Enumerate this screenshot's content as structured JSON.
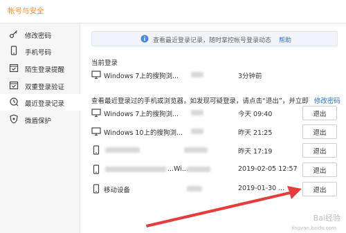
{
  "header": {
    "title": "帐号与安全"
  },
  "sidebar": {
    "items": [
      {
        "label": "修改密码",
        "icon": "key-icon"
      },
      {
        "label": "手机号码",
        "icon": "phone-icon"
      },
      {
        "label": "陌生登录提醒",
        "icon": "calendar-check-icon"
      },
      {
        "label": "双重登录验证",
        "icon": "calendar-check-icon"
      },
      {
        "label": "最近登录记录",
        "icon": "history-icon",
        "active": true
      },
      {
        "label": "微盾保护",
        "icon": "shield-icon"
      }
    ]
  },
  "notice": {
    "text": "查看最近登录记录，随时掌控帐号登录动态",
    "help_label": "帮助"
  },
  "current": {
    "heading": "当前登录",
    "device": "Windows 7上的搜狗浏...",
    "time": "3分钟前"
  },
  "history": {
    "heading": "查看最近登录过的手机或浏览器，如发现可疑登录，请点击“退出”，并立即",
    "change_password_link": "修改密码",
    "logout_label": "退出",
    "rows": [
      {
        "device": "Windows 7上的搜狗浏...",
        "time": "今天 09:40",
        "icon": "monitor-icon"
      },
      {
        "device": "Windows 10上的搜狗浏...",
        "time": "昨天 21:25",
        "icon": "monitor-icon"
      },
      {
        "device": "",
        "time": "昨天 17:19",
        "icon": "mobile-icon"
      },
      {
        "device": "...Wi...",
        "time": "2019-02-05 12:57",
        "icon": "mobile-icon"
      },
      {
        "device": "移动设备",
        "time": "2019-01-30 ...",
        "icon": "mobile-icon"
      }
    ]
  },
  "watermark": {
    "brand": "Bai经验",
    "url": "jingyan.baidu.com"
  },
  "colors": {
    "accent": "#f08c2e",
    "link": "#2a6fd3",
    "arrow": "#e83b3b"
  }
}
